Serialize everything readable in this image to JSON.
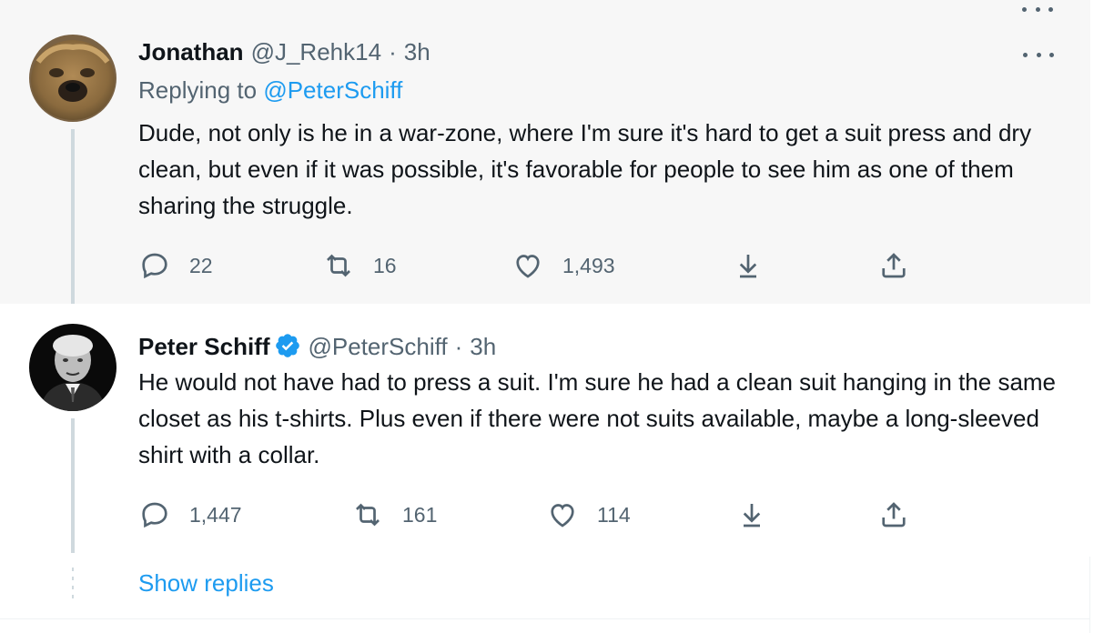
{
  "tweets": [
    {
      "display_name": "Jonathan",
      "handle": "@J_Rehk14",
      "separator": "·",
      "time": "3h",
      "replying_prefix": "Replying to",
      "replying_to": "@PeterSchiff",
      "text": "Dude, not only is he in a war-zone, where I'm sure it's hard to get a suit press and dry clean, but even if it was possible, it's favorable for people to see him as one of them sharing the struggle.",
      "replies": "22",
      "retweets": "16",
      "likes": "1,493"
    },
    {
      "display_name": "Peter Schiff",
      "verified": true,
      "handle": "@PeterSchiff",
      "separator": "·",
      "time": "3h",
      "text": "He would not have had to press a suit. I'm sure he had a clean suit hanging in the same closet as his t-shirts. Plus even if there were not suits available, maybe a long-sleeved shirt with a collar.",
      "replies": "1,447",
      "retweets": "161",
      "likes": "114"
    }
  ],
  "show_replies_label": "Show replies",
  "colors": {
    "accent": "#1d9bf0",
    "secondary_text": "#536471",
    "primary_text": "#0f1419",
    "highlight_bg": "#f7f7f7",
    "thread_line": "#cfd9de"
  },
  "icons": {
    "reply": "reply-icon",
    "retweet": "retweet-icon",
    "like": "heart-icon",
    "bookmark": "download-icon",
    "share": "share-icon",
    "more": "more-icon",
    "verified": "verified-badge-icon"
  }
}
